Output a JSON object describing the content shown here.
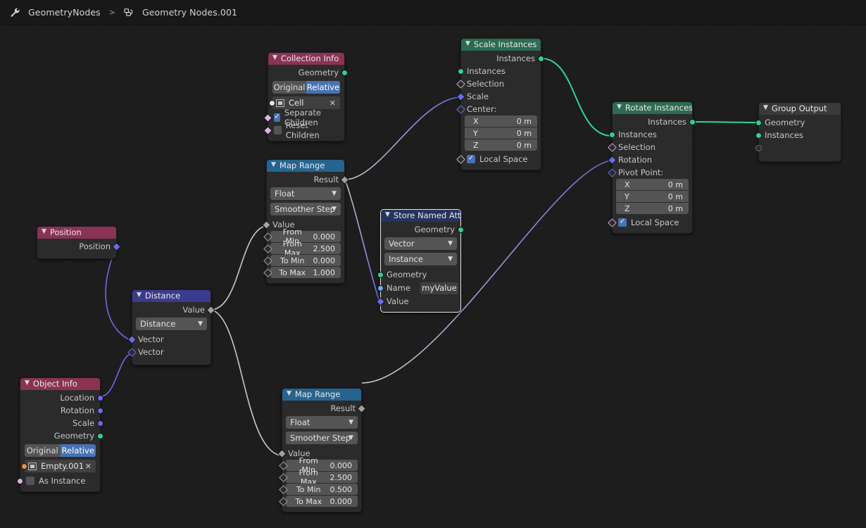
{
  "app": {
    "breadcrumb_root": "GeometryNodes",
    "breadcrumb_separator": ">",
    "breadcrumb_current": "Geometry Nodes.001",
    "wrench_icon": "wrench-icon",
    "nodetree_icon": "node-tree-icon"
  },
  "colors": {
    "editor_background": "#1d1d1d",
    "header_bar": "#181818",
    "node_body": "#2b2b2b",
    "header_geometry": "#2d6b52",
    "header_input": "#8a3355",
    "header_converter": "#266490",
    "header_vector": "#3b3b8e",
    "header_attribute": "#23355e",
    "header_output": "#3a3a3a",
    "socket_geometry": "#2ecf9c",
    "socket_vector": "#6a6ae8",
    "socket_float": "#a1a1a1",
    "socket_boolean": "#d9b7dd",
    "socket_string": "#70a8ef",
    "socket_object": "#eb8e4b",
    "toggle_active": "#4772b3",
    "link_geometry": "#2dd49a",
    "link_vector": "#6a6ae8",
    "link_float": "#c9c9c9"
  },
  "nodes": {
    "collection_info": {
      "title": "Collection Info",
      "outputs": [
        {
          "label": "Geometry",
          "type": "geometry"
        }
      ],
      "transform_space": {
        "options": [
          "Original",
          "Relative"
        ],
        "selected": "Relative"
      },
      "collection_field": {
        "value": "Cell",
        "clear_label": "✕"
      },
      "separate_children": {
        "label": "Separate Children",
        "checked": true
      },
      "reset_children": {
        "label": "Reset Children",
        "checked": false
      }
    },
    "scale_instances": {
      "title": "Scale Instances",
      "outputs": [
        {
          "label": "Instances",
          "type": "geometry"
        }
      ],
      "inputs": [
        {
          "label": "Instances",
          "type": "geometry"
        },
        {
          "label": "Selection",
          "type": "boolean"
        },
        {
          "label": "Scale",
          "type": "vector"
        },
        {
          "label": "Center:",
          "type": "vector"
        }
      ],
      "center": [
        {
          "name": "X",
          "value": "0 m"
        },
        {
          "name": "Y",
          "value": "0 m"
        },
        {
          "name": "Z",
          "value": "0 m"
        }
      ],
      "local_space": {
        "label": "Local Space",
        "checked": true
      }
    },
    "rotate_instances": {
      "title": "Rotate Instances",
      "outputs": [
        {
          "label": "Instances",
          "type": "geometry"
        }
      ],
      "inputs": [
        {
          "label": "Instances",
          "type": "geometry"
        },
        {
          "label": "Selection",
          "type": "boolean"
        },
        {
          "label": "Rotation",
          "type": "vector"
        },
        {
          "label": "Pivot Point:",
          "type": "vector"
        }
      ],
      "pivot": [
        {
          "name": "X",
          "value": "0 m"
        },
        {
          "name": "Y",
          "value": "0 m"
        },
        {
          "name": "Z",
          "value": "0 m"
        }
      ],
      "local_space": {
        "label": "Local Space",
        "checked": true
      }
    },
    "group_output": {
      "title": "Group Output",
      "inputs": [
        {
          "label": "Geometry",
          "type": "geometry"
        },
        {
          "label": "Instances",
          "type": "geometry"
        },
        {
          "label": "",
          "type": "empty"
        }
      ]
    },
    "map_range_top": {
      "title": "Map Range",
      "outputs": [
        {
          "label": "Result",
          "type": "float"
        }
      ],
      "data_type": {
        "selected": "Float"
      },
      "interpolation": {
        "selected": "Smoother Step"
      },
      "value_input": {
        "label": "Value",
        "type": "float"
      },
      "fields": [
        {
          "name": "From Min",
          "value": "0.000"
        },
        {
          "name": "From Max",
          "value": "2.500"
        },
        {
          "name": "To Min",
          "value": "0.000"
        },
        {
          "name": "To Max",
          "value": "1.000"
        }
      ]
    },
    "map_range_bottom": {
      "title": "Map Range",
      "outputs": [
        {
          "label": "Result",
          "type": "float"
        }
      ],
      "data_type": {
        "selected": "Float"
      },
      "interpolation": {
        "selected": "Smoother Step"
      },
      "value_input": {
        "label": "Value",
        "type": "float"
      },
      "fields": [
        {
          "name": "From Min",
          "value": "0.000"
        },
        {
          "name": "From Max",
          "value": "2.500"
        },
        {
          "name": "To Min",
          "value": "0.500"
        },
        {
          "name": "To Max",
          "value": "0.000"
        }
      ]
    },
    "store_named_attribute": {
      "title": "Store Named Attribute",
      "selected": true,
      "outputs": [
        {
          "label": "Geometry",
          "type": "geometry"
        }
      ],
      "data_type": {
        "selected": "Vector"
      },
      "domain": {
        "selected": "Instance"
      },
      "inputs": [
        {
          "label": "Geometry",
          "type": "geometry"
        },
        {
          "label": "Name",
          "type": "string"
        },
        {
          "label": "Value",
          "type": "vector"
        }
      ],
      "name_value": "myValue"
    },
    "position": {
      "title": "Position",
      "outputs": [
        {
          "label": "Position",
          "type": "vector"
        }
      ]
    },
    "distance": {
      "title": "Distance",
      "outputs": [
        {
          "label": "Value",
          "type": "float"
        }
      ],
      "operation": {
        "selected": "Distance"
      },
      "inputs": [
        {
          "label": "Vector",
          "type": "vector"
        },
        {
          "label": "Vector",
          "type": "vector"
        }
      ]
    },
    "object_info": {
      "title": "Object Info",
      "outputs": [
        {
          "label": "Location",
          "type": "vector"
        },
        {
          "label": "Rotation",
          "type": "vector"
        },
        {
          "label": "Scale",
          "type": "vector"
        },
        {
          "label": "Geometry",
          "type": "geometry"
        }
      ],
      "transform_space": {
        "options": [
          "Original",
          "Relative"
        ],
        "selected": "Relative"
      },
      "object_field": {
        "value": "Empty.001",
        "clear_label": "✕"
      },
      "as_instance": {
        "label": "As Instance",
        "checked": false
      }
    }
  }
}
